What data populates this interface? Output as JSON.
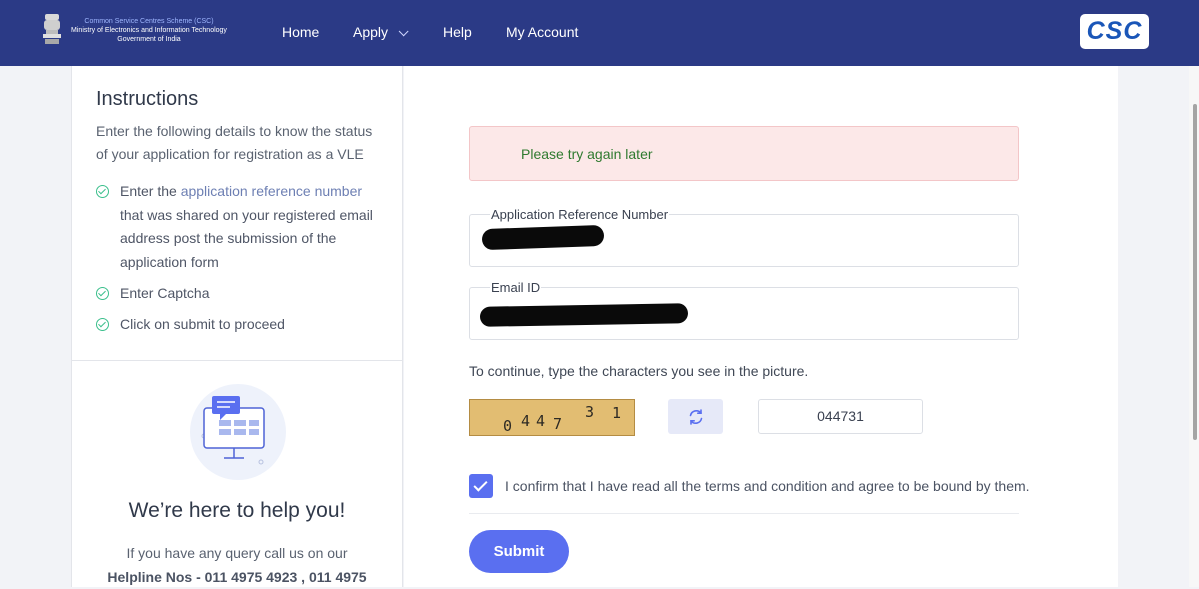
{
  "header": {
    "org_line1": "Common Service Centres Scheme (CSC)",
    "org_line2": "Ministry of Electronics and Information Technology",
    "org_line3": "Government of India",
    "nav": {
      "home": "Home",
      "apply": "Apply",
      "help": "Help",
      "my_account": "My Account"
    },
    "logo_text": "CSC"
  },
  "instructions": {
    "title": "Instructions",
    "description": "Enter the following details to know the status of your application for registration as a VLE",
    "steps": [
      {
        "prefix": "Enter the ",
        "link": "application reference number",
        "suffix": " that was shared on your registered email address post the submission of the application form"
      },
      {
        "text": "Enter Captcha"
      },
      {
        "text": "Click on submit to proceed"
      }
    ]
  },
  "help": {
    "title": "We’re here to help you!",
    "line1": "If you have any query call us on our",
    "line2": "Helpline Nos - 011 4975 4923 , 011 4975"
  },
  "form": {
    "alert": "Please try again later",
    "ref_label": "Application Reference Number",
    "email_label": "Email ID",
    "captcha_prompt": "To continue, type the characters you see in the picture.",
    "captcha_chars": [
      "0",
      "4",
      "4",
      "7",
      "3",
      "1"
    ],
    "captcha_value": "044731",
    "terms": "I confirm that I have read all the terms and condition and agree to be bound by them.",
    "terms_checked": true,
    "submit": "Submit"
  },
  "colors": {
    "header_bg": "#2b3a86",
    "accent": "#5a6ff0",
    "success": "#3bbf8c",
    "alert_bg": "#fce8e8",
    "alert_text": "#2f7a2f"
  }
}
